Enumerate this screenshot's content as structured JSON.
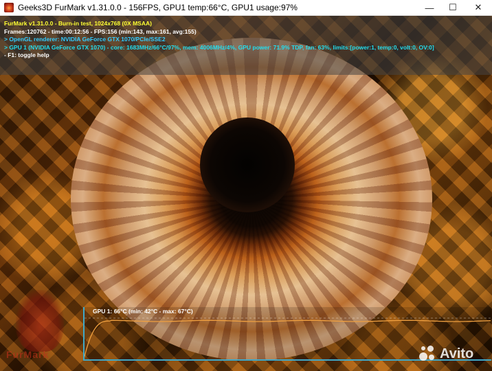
{
  "window": {
    "title": "Geeks3D FurMark v1.31.0.0 - 156FPS, GPU1 temp:66°C, GPU1 usage:97%",
    "minimize": "—",
    "maximize": "☐",
    "close": "✕"
  },
  "hud": {
    "line1": "FurMark v1.31.0.0 - Burn-in test, 1024x768 (0X MSAA)",
    "line2": "Frames:120762 - time:00:12:56 - FPS:156 (min:143, max:161, avg:155)",
    "line3": "> OpenGL renderer: NVIDIA GeForce GTX 1070/PCIe/SSE2",
    "line4": "> GPU 1 (NVIDIA GeForce GTX 1070) - core: 1683MHz/66°C/97%, mem: 4006MHz/4%, GPU power: 71.9% TDP, fan: 63%, limits:[power:1, temp:0, volt:0, OV:0]",
    "line5": "- F1: toggle help"
  },
  "graph": {
    "label": "GPU 1: 66°C (min: 42°C - max: 67°C)",
    "line_color": "#f0a040",
    "axis_color": "#3fa8c8",
    "temp_current": 66,
    "temp_min": 42,
    "temp_max": 67
  },
  "logo": {
    "text": "FurMark"
  },
  "watermark": {
    "text": "Avito"
  }
}
